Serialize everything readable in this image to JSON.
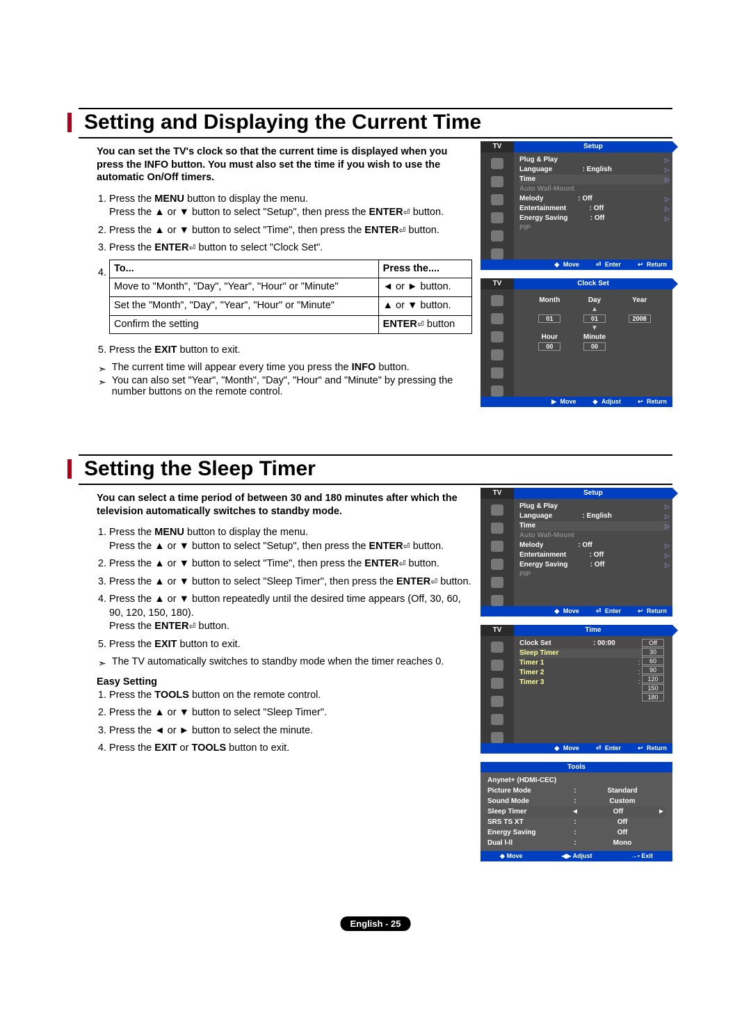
{
  "section1": {
    "title": "Setting and Displaying the Current Time",
    "intro": "You can set the TV's clock so that the current time is displayed when you press the INFO button. You must also set the time if you wish to use the automatic On/Off timers.",
    "steps": {
      "s1a": "Press the ",
      "s1b": "MENU",
      "s1c": " button to display the menu.",
      "s1d": "Press the ▲ or ▼ button to select \"Setup\", then press the ",
      "s1e": "ENTER",
      "s1f": " button.",
      "s2a": "Press the ▲ or ▼ button to select \"Time\", then press the ",
      "s2b": "ENTER",
      "s2c": " button.",
      "s3a": "Press the ",
      "s3b": "ENTER",
      "s3c": " button to select \"Clock Set\"."
    },
    "table": {
      "h1": "To...",
      "h2": "Press the....",
      "r1c1": "Move to \"Month\", \"Day\", \"Year\", \"Hour\" or \"Minute\"",
      "r1c2": "◄ or ► button.",
      "r2c1": "Set the \"Month\", \"Day\", \"Year\", \"Hour\" or \"Minute\"",
      "r2c2": "▲ or ▼ button.",
      "r3c1": "Confirm the setting",
      "r3c2a": "ENTER",
      "r3c2b": " button"
    },
    "s5a": "Press the ",
    "s5b": "EXIT",
    "s5c": " button to exit.",
    "note1a": "The current time will appear every time you press the ",
    "note1b": "INFO",
    "note1c": " button.",
    "note2": "You can also set \"Year\", \"Month\", \"Day\", \"Hour\" and \"Minute\" by pressing the number buttons on the remote control."
  },
  "section2": {
    "title": "Setting the Sleep Timer",
    "intro": "You can select a time period of between 30 and 180 minutes after which the television automatically switches to standby mode.",
    "s1a": "Press the ",
    "s1b": "MENU",
    "s1c": " button to display the menu.",
    "s1d": "Press the ▲ or ▼ button to select \"Setup\", then press the ",
    "s1e": "ENTER",
    "s1f": " button.",
    "s2a": "Press the ▲ or ▼ button to select \"Time\", then press the ",
    "s2b": "ENTER",
    "s2c": " button.",
    "s3a": "Press the ▲ or ▼ button to select \"Sleep Timer\", then press the ",
    "s3b": "ENTER",
    "s3c": " button.",
    "s4a": "Press the ▲ or ▼ button repeatedly until the desired time appears (Off, 30, 60, 90, 120, 150, 180).",
    "s4b": "Press the ",
    "s4c": "ENTER",
    "s4d": " button.",
    "s5a": "Press the ",
    "s5b": "EXIT",
    "s5c": " button to exit.",
    "note1": "The TV automatically switches to standby mode when the timer reaches 0.",
    "easy_head": "Easy Setting",
    "e1a": "Press the ",
    "e1b": "TOOLS",
    "e1c": " button on the remote control.",
    "e2": "Press the ▲ or ▼ button to select \"Sleep Timer\".",
    "e3": "Press the ◄ or ► button to select the minute.",
    "e4a": "Press the ",
    "e4b": "EXIT",
    "e4c": " or ",
    "e4d": "TOOLS",
    "e4e": " button to exit."
  },
  "osd_setup": {
    "tv": "TV",
    "title": "Setup",
    "items": {
      "plug": {
        "l": "Plug & Play"
      },
      "lang": {
        "l": "Language",
        "v": ": English"
      },
      "time": {
        "l": "Time"
      },
      "awm": {
        "l": "Auto Wall-Mount"
      },
      "melody": {
        "l": "Melody",
        "v": ": Off"
      },
      "ent": {
        "l": "Entertainment",
        "v": ": Off"
      },
      "energy": {
        "l": "Energy Saving",
        "v": ": Off"
      },
      "pip": {
        "l": "PIP"
      }
    },
    "foot": {
      "move": "Move",
      "enter": "Enter",
      "ret": "Return"
    }
  },
  "osd_clock": {
    "title": "Clock Set",
    "h": {
      "month": "Month",
      "day": "Day",
      "year": "Year",
      "hour": "Hour",
      "minute": "Minute"
    },
    "v": {
      "month": "01",
      "day": "01",
      "year": "2008",
      "hour": "00",
      "minute": "00"
    },
    "foot": {
      "move": "Move",
      "adjust": "Adjust",
      "ret": "Return"
    }
  },
  "osd_time": {
    "title": "Time",
    "rows": {
      "clock": {
        "l": "Clock Set",
        "v": ": 00:00"
      },
      "sleep": {
        "l": "Sleep Timer"
      },
      "t1": {
        "l": "Timer 1"
      },
      "t2": {
        "l": "Timer 2"
      },
      "t3": {
        "l": "Timer 3"
      }
    },
    "opts": [
      "Off",
      "30",
      "60",
      "90",
      "120",
      "150",
      "180"
    ]
  },
  "tools": {
    "title": "Tools",
    "rows": {
      "anynet": {
        "l": "Anynet+ (HDMI-CEC)"
      },
      "pic": {
        "l": "Picture Mode",
        "v": "Standard"
      },
      "sound": {
        "l": "Sound Mode",
        "v": "Custom"
      },
      "sleep": {
        "l": "Sleep Timer",
        "v": "Off"
      },
      "srs": {
        "l": "SRS TS XT",
        "v": "Off"
      },
      "energy": {
        "l": "Energy Saving",
        "v": "Off"
      },
      "dual": {
        "l": "Dual l-ll",
        "v": "Mono"
      }
    },
    "foot": {
      "move": "Move",
      "adjust": "Adjust",
      "exit": "Exit"
    }
  },
  "footer": "English - 25",
  "glyph": {
    "enter": "⏎",
    "updown": "◆",
    "leftright": "◀▶",
    "return": "↩",
    "exit": "▪"
  }
}
